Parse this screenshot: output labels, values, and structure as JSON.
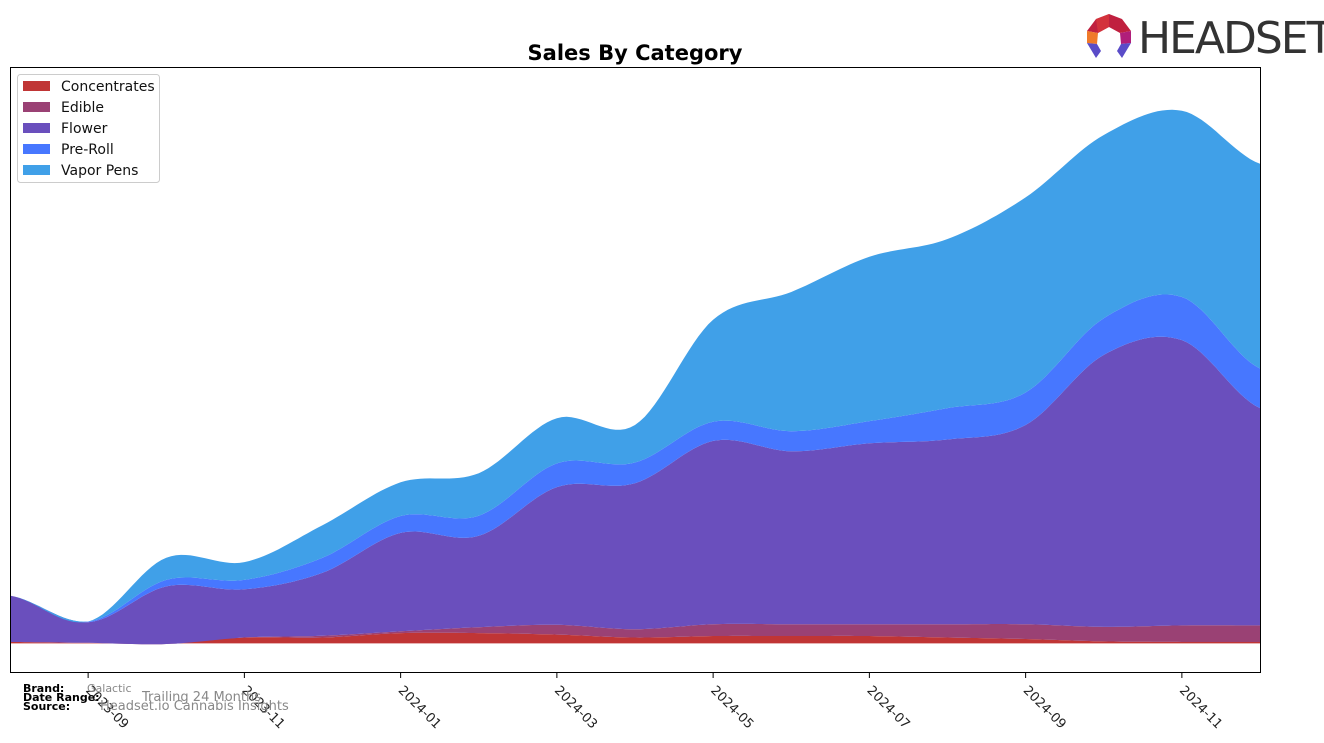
{
  "header": {
    "logo_text": "HEADSET"
  },
  "footer": {
    "brand_label": "Brand:",
    "brand_value": "Galactic",
    "date_range_label": "Date Range:",
    "date_range_value": "Trailing 24 Months",
    "source_label": "Source:",
    "source_value": "Headset.io Cannabis Insights"
  },
  "chart_data": {
    "type": "area",
    "stacked": true,
    "smoothed": true,
    "title": "Sales By Category",
    "xlabel": "",
    "ylabel": "",
    "y_axis_visible": false,
    "grid": false,
    "legend_position": "top-left",
    "x": [
      "2023-08",
      "2023-09",
      "2023-10",
      "2023-11",
      "2023-12",
      "2024-01",
      "2024-02",
      "2024-03",
      "2024-04",
      "2024-05",
      "2024-06",
      "2024-07",
      "2024-08",
      "2024-09",
      "2024-10",
      "2024-11",
      "2024-12"
    ],
    "x_tick_labels": [
      "2023-09",
      "2023-11",
      "2024-01",
      "2024-03",
      "2024-05",
      "2024-07",
      "2024-09",
      "2024-11"
    ],
    "units": "relative sales (y-axis unlabeled)",
    "ylim": [
      -10,
      195
    ],
    "series": [
      {
        "name": "Concentrates",
        "color": "#c03535",
        "values": [
          0.5,
          0.2,
          0.2,
          2.0,
          2.0,
          3.5,
          3.5,
          3.0,
          2.0,
          2.5,
          2.5,
          2.5,
          2.0,
          1.5,
          0.7,
          0.5,
          0.5
        ]
      },
      {
        "name": "Edible",
        "color": "#9a4174",
        "values": [
          0.0,
          0.0,
          -0.4,
          0.0,
          0.6,
          0.6,
          2.0,
          3.3,
          2.8,
          4.0,
          4.0,
          4.0,
          4.5,
          5.0,
          4.9,
          5.6,
          5.6
        ]
      },
      {
        "name": "Flower",
        "color": "#6a4fbd",
        "values": [
          15.7,
          7.0,
          19.5,
          16.3,
          21.3,
          33.3,
          30.9,
          46.6,
          49.4,
          62.0,
          58.5,
          61.2,
          62.5,
          67.4,
          92.0,
          96.5,
          73.5
        ]
      },
      {
        "name": "Pre-Roll",
        "color": "#4777ff",
        "values": [
          0.0,
          0.2,
          2.2,
          3.2,
          5.1,
          5.7,
          6.8,
          8.0,
          7.0,
          6.5,
          6.8,
          7.5,
          10.6,
          11.0,
          12.4,
          14.6,
          13.4
        ]
      },
      {
        "name": "Vapor Pens",
        "color": "#40a0e8",
        "values": [
          0.0,
          0.0,
          7.5,
          6.0,
          11.0,
          11.4,
          14.4,
          15.3,
          12.7,
          34.5,
          47.1,
          55.6,
          57.2,
          66.0,
          62.0,
          63.0,
          69.3
        ]
      }
    ]
  }
}
